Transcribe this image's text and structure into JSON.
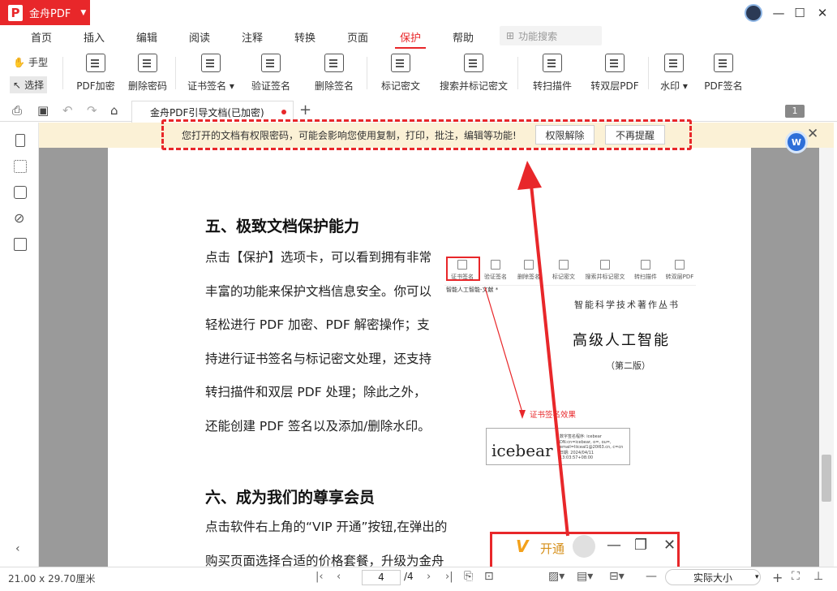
{
  "app": {
    "name": "金舟PDF",
    "logo_letter": "P",
    "accent": "#e8272a"
  },
  "window_controls": {
    "minimize": "—",
    "maximize": "☐",
    "close": "✕"
  },
  "menu": {
    "tabs": [
      "首页",
      "插入",
      "编辑",
      "阅读",
      "注释",
      "转换",
      "页面",
      "保护",
      "帮助"
    ],
    "active": "保护",
    "search_placeholder": "功能搜索"
  },
  "toolbar": {
    "hand": "手型",
    "select": "选择",
    "tools": [
      {
        "label": "PDF加密",
        "icon": "lock-icon"
      },
      {
        "label": "删除密码",
        "icon": "unlock-icon"
      },
      {
        "label": "证书签名",
        "icon": "certificate-icon",
        "dropdown": true
      },
      {
        "label": "验证签名",
        "icon": "verify-icon"
      },
      {
        "label": "删除签名",
        "icon": "delete-sign-icon"
      },
      {
        "label": "标记密文",
        "icon": "mark-icon"
      },
      {
        "label": "搜索并标记密文",
        "icon": "search-mark-icon"
      },
      {
        "label": "转扫描件",
        "icon": "scan-icon"
      },
      {
        "label": "转双层PDF",
        "icon": "dual-layer-icon"
      },
      {
        "label": "水印",
        "icon": "watermark-icon",
        "dropdown": true
      },
      {
        "label": "PDF签名",
        "icon": "pen-icon"
      }
    ]
  },
  "doc_tab": {
    "title": "金舟PDF引导文档(已加密)",
    "new_tab": "+",
    "page_badge": "1"
  },
  "notice": {
    "text": "您打开的文档有权限密码，可能会影响您使用复制，打印，批注，编辑等功能!",
    "btn_release": "权限解除",
    "btn_dismiss": "不再提醒",
    "close": "✕"
  },
  "doc": {
    "h5": "五、极致文档保护能力",
    "para5": [
      "点击【保护】选项卡，可以看到拥有非常",
      "丰富的功能来保护文档信息安全。你可以",
      "轻松进行 PDF 加密、PDF 解密操作；支",
      "持进行证书签名与标记密文处理，还支持",
      "转扫描件和双层 PDF 处理；除此之外，",
      "还能创建 PDF 签名以及添加/删除水印。"
    ],
    "h6": "六、成为我们的尊享会员",
    "para6": [
      "点击软件右上角的“VIP 开通”按钮,在弹出的",
      "购买页面选择合适的价格套餐，升级为金舟"
    ]
  },
  "embedded": {
    "tools": [
      "证书签名",
      "验证签名",
      "删除签名",
      "标记密文",
      "搜索并标记密文",
      "转扫描件",
      "转双层PDF"
    ],
    "tab": "智能人工智能-文献 *",
    "book_series": "智能科学技术著作丛书",
    "book_title": "高级人工智能",
    "book_edition": "（第二版）",
    "cert_label": "证书签名效果",
    "sig_name": "icebear",
    "sig_detail": "数字签名程序: icebear DN:cn=icebear, o=, ou=, email=liiceal1@20l63.cn, c=cn 日期: 2024/04/11 13:03:57+08:00"
  },
  "vip": {
    "logo": "V",
    "open": "开通",
    "min": "—",
    "restore": "❐",
    "close": "✕"
  },
  "status": {
    "dimensions": "21.00 x 29.70厘米",
    "page_current": "4",
    "page_total": "/4",
    "zoom": "实际大小"
  }
}
